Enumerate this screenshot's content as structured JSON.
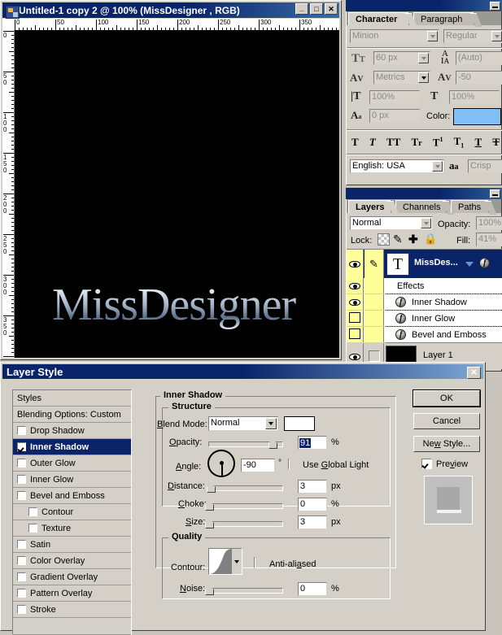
{
  "image_window": {
    "title": "Untitled-1 copy 2 @ 100% (MissDesigner , RGB)",
    "minimize_glyph": "_",
    "maximize_glyph": "□",
    "close_glyph": "✕",
    "canvas_text": "MissDesigner",
    "canvas_bg": "#000000",
    "ruler_ticks_h": [
      "0",
      "50",
      "100",
      "150",
      "200",
      "250",
      "300",
      "350"
    ],
    "ruler_ticks_v": [
      "0",
      "50",
      "100",
      "150",
      "200",
      "250",
      "300",
      "350"
    ]
  },
  "character_palette": {
    "tabs": [
      {
        "label": "Character",
        "active": true
      },
      {
        "label": "Paragraph",
        "active": false
      }
    ],
    "font_family": "Minion",
    "font_style": "Regular",
    "font_size": "60 px",
    "leading": "(Auto)",
    "kerning": "Metrics",
    "tracking": "-50",
    "vertical_scale": "100%",
    "horizontal_scale": "100%",
    "baseline_shift": "0 px",
    "color_label": "Color:",
    "color_value": "#82bff5",
    "style_buttons": [
      "T",
      "T",
      "TT",
      "Tr",
      "T1",
      "T1",
      "T",
      "T"
    ],
    "language": "English: USA",
    "anti_alias_icon": "aa",
    "anti_alias": "Crisp"
  },
  "layers_palette": {
    "tabs": [
      {
        "label": "Layers",
        "active": true
      },
      {
        "label": "Channels",
        "active": false
      },
      {
        "label": "Paths",
        "active": false
      }
    ],
    "blend_mode": "Normal",
    "opacity_label": "Opacity:",
    "opacity_value": "100%",
    "lock_label": "Lock:",
    "lock_icons": [
      "transparency-icon",
      "brush-icon",
      "move-icon",
      "lock-icon"
    ],
    "fill_label": "Fill:",
    "fill_value": "41%",
    "rows": [
      {
        "name": "MissDes...",
        "type": "text-layer",
        "thumb": "T",
        "selected": true,
        "visible": true
      },
      {
        "name": "Effects",
        "type": "effects-header",
        "visible": true
      },
      {
        "name": "Inner Shadow",
        "type": "effect",
        "visible": true
      },
      {
        "name": "Inner Glow",
        "type": "effect",
        "visible": false
      },
      {
        "name": "Bevel and Emboss",
        "type": "effect",
        "visible": false
      },
      {
        "name": "Layer 1",
        "type": "pixel-layer",
        "visible": true
      }
    ]
  },
  "layer_style_dialog": {
    "title": "Layer Style",
    "close_glyph": "✕",
    "styles_header": "Styles",
    "styles": [
      {
        "label": "Blending Options: Custom",
        "checkbox": false,
        "checked": false,
        "selected": false,
        "indent": false
      },
      {
        "label": "Drop Shadow",
        "checkbox": true,
        "checked": false,
        "selected": false,
        "indent": false
      },
      {
        "label": "Inner Shadow",
        "checkbox": true,
        "checked": true,
        "selected": true,
        "indent": false
      },
      {
        "label": "Outer Glow",
        "checkbox": true,
        "checked": false,
        "selected": false,
        "indent": false
      },
      {
        "label": "Inner Glow",
        "checkbox": true,
        "checked": false,
        "selected": false,
        "indent": false
      },
      {
        "label": "Bevel and Emboss",
        "checkbox": true,
        "checked": false,
        "selected": false,
        "indent": false
      },
      {
        "label": "Contour",
        "checkbox": true,
        "checked": false,
        "selected": false,
        "indent": true
      },
      {
        "label": "Texture",
        "checkbox": true,
        "checked": false,
        "selected": false,
        "indent": true
      },
      {
        "label": "Satin",
        "checkbox": true,
        "checked": false,
        "selected": false,
        "indent": false
      },
      {
        "label": "Color Overlay",
        "checkbox": true,
        "checked": false,
        "selected": false,
        "indent": false
      },
      {
        "label": "Gradient Overlay",
        "checkbox": true,
        "checked": false,
        "selected": false,
        "indent": false
      },
      {
        "label": "Pattern Overlay",
        "checkbox": true,
        "checked": false,
        "selected": false,
        "indent": false
      },
      {
        "label": "Stroke",
        "checkbox": true,
        "checked": false,
        "selected": false,
        "indent": false
      }
    ],
    "panel_title": "Inner Shadow",
    "structure": {
      "group_title": "Structure",
      "blend_mode_label": "Blend Mode:",
      "blend_mode_value": "Normal",
      "shadow_color": "#ffffff",
      "opacity_label": "Opacity:",
      "opacity_value": "91",
      "opacity_unit": "%",
      "opacity_pct": 91,
      "angle_label": "Angle:",
      "angle_value": "-90",
      "angle_unit": "°",
      "use_global_light_label": "Use Global Light",
      "use_global_light_checked": false,
      "distance_label": "Distance:",
      "distance_value": "3",
      "distance_unit": "px",
      "distance_pct": 2,
      "choke_label": "Choke:",
      "choke_value": "0",
      "choke_unit": "%",
      "choke_pct": 0,
      "size_label": "Size:",
      "size_value": "3",
      "size_unit": "px",
      "size_pct": 0
    },
    "quality": {
      "group_title": "Quality",
      "contour_label": "Contour:",
      "anti_aliased_label": "Anti-aliased",
      "anti_aliased_checked": false,
      "noise_label": "Noise:",
      "noise_value": "0",
      "noise_unit": "%",
      "noise_pct": 0
    },
    "buttons": {
      "ok": "OK",
      "cancel": "Cancel",
      "new_style": "New Style...",
      "preview_label": "Preview",
      "preview_checked": true
    }
  }
}
